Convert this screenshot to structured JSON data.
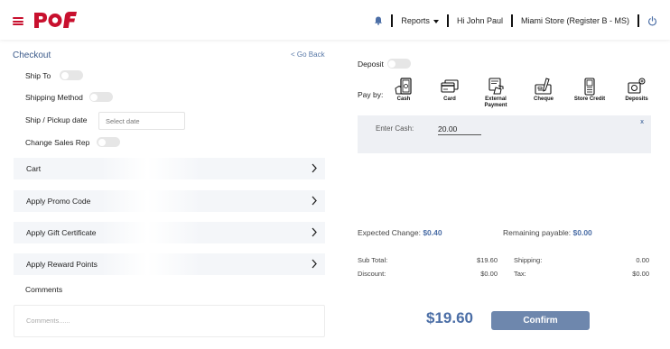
{
  "header": {
    "reports_label": "Reports",
    "greeting": "Hi John Paul",
    "store": "Miami Store (Register B - MS)",
    "brand_color": "#c8102e"
  },
  "checkout": {
    "title": "Checkout",
    "go_back": "< Go Back",
    "options": {
      "ship_to": "Ship To",
      "shipping_method": "Shipping Method",
      "ship_pickup_date": "Ship / Pickup date",
      "date_placeholder": "Select date",
      "change_sales_rep": "Change Sales Rep"
    },
    "sections": [
      "Cart",
      "Apply Promo Code",
      "Apply Gift Certificate",
      "Apply Reward Points"
    ],
    "comments_label": "Comments",
    "comments_placeholder": "Comments......"
  },
  "payment": {
    "deposit_label": "Deposit",
    "pay_by_label": "Pay by:",
    "methods": [
      {
        "label": "Cash",
        "icon": "cash-icon"
      },
      {
        "label": "Card",
        "icon": "card-icon"
      },
      {
        "label": "External Payment",
        "icon": "external-payment-icon"
      },
      {
        "label": "Cheque",
        "icon": "cheque-icon"
      },
      {
        "label": "Store Credit",
        "icon": "store-credit-icon"
      },
      {
        "label": "Deposits",
        "icon": "deposits-icon"
      }
    ],
    "cash_entry": {
      "label": "Enter Cash:",
      "value": "20.00",
      "close": "x"
    }
  },
  "summary": {
    "expected_change_label": "Expected Change:",
    "expected_change_value": "$0.40",
    "remaining_payable_label": "Remaining payable:",
    "remaining_payable_value": "$0.00",
    "sub_total_label": "Sub Total:",
    "sub_total_value": "$19.60",
    "discount_label": "Discount:",
    "discount_value": "$0.00",
    "shipping_label": "Shipping:",
    "shipping_value": "0.00",
    "tax_label": "Tax:",
    "tax_value": "$0.00",
    "total": "$19.60",
    "confirm_label": "Confirm",
    "accent_color": "#4b6ea6"
  }
}
